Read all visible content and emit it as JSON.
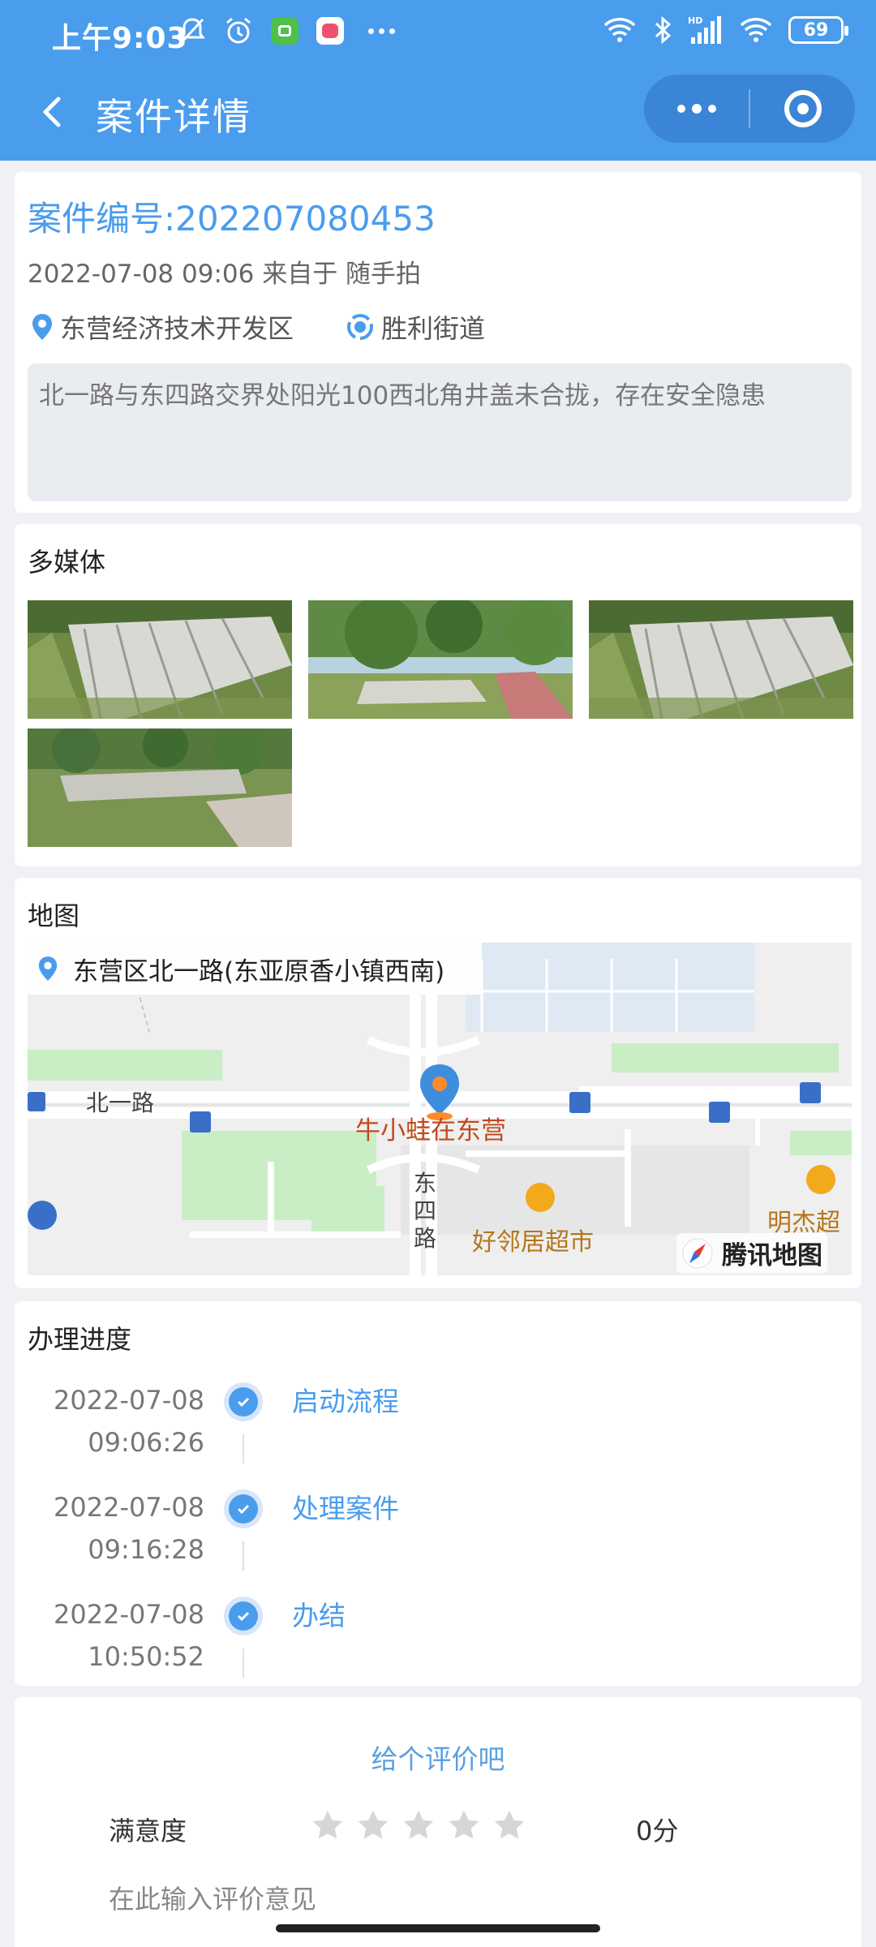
{
  "status_bar": {
    "time": "上午9:03",
    "battery": "69",
    "icons": [
      "bell-off-icon",
      "alarm-icon",
      "app-notification-icon",
      "app-notification-icon",
      "more-icon",
      "wifi-icon",
      "bluetooth-icon",
      "hd-signal-icon",
      "wifi-icon",
      "battery-icon"
    ]
  },
  "nav": {
    "title": "案件详情"
  },
  "case": {
    "number_label": "案件编号:202207080453",
    "meta": "2022-07-08 09:06 来自于 随手拍",
    "district": "东营经济技术开发区",
    "street": "胜利街道",
    "description": "北一路与东四路交界处阳光100西北角井盖未合拢，存在安全隐患"
  },
  "media": {
    "title": "多媒体",
    "count": 4
  },
  "map": {
    "title": "地图",
    "address": "东营区北一路(东亚原香小镇西南)",
    "labels": {
      "road_north": "北一路",
      "road_east": "东四路",
      "poi_main": "牛小蛙在东营",
      "poi_market": "好邻居超市",
      "poi_market2": "明杰超",
      "brand": "腾讯地图"
    }
  },
  "progress": {
    "title": "办理进度",
    "steps": [
      {
        "date": "2022-07-08",
        "time": "09:06:26",
        "label": "启动流程"
      },
      {
        "date": "2022-07-08",
        "time": "09:16:28",
        "label": "处理案件"
      },
      {
        "date": "2022-07-08",
        "time": "10:50:52",
        "label": "办结"
      }
    ]
  },
  "rating": {
    "title": "给个评价吧",
    "satisfaction_label": "满意度",
    "stars_filled": 0,
    "stars_total": 5,
    "score": "0分",
    "comment_placeholder": "在此输入评价意见"
  },
  "colors": {
    "primary": "#4a9ced",
    "background": "#f0f1f4"
  }
}
